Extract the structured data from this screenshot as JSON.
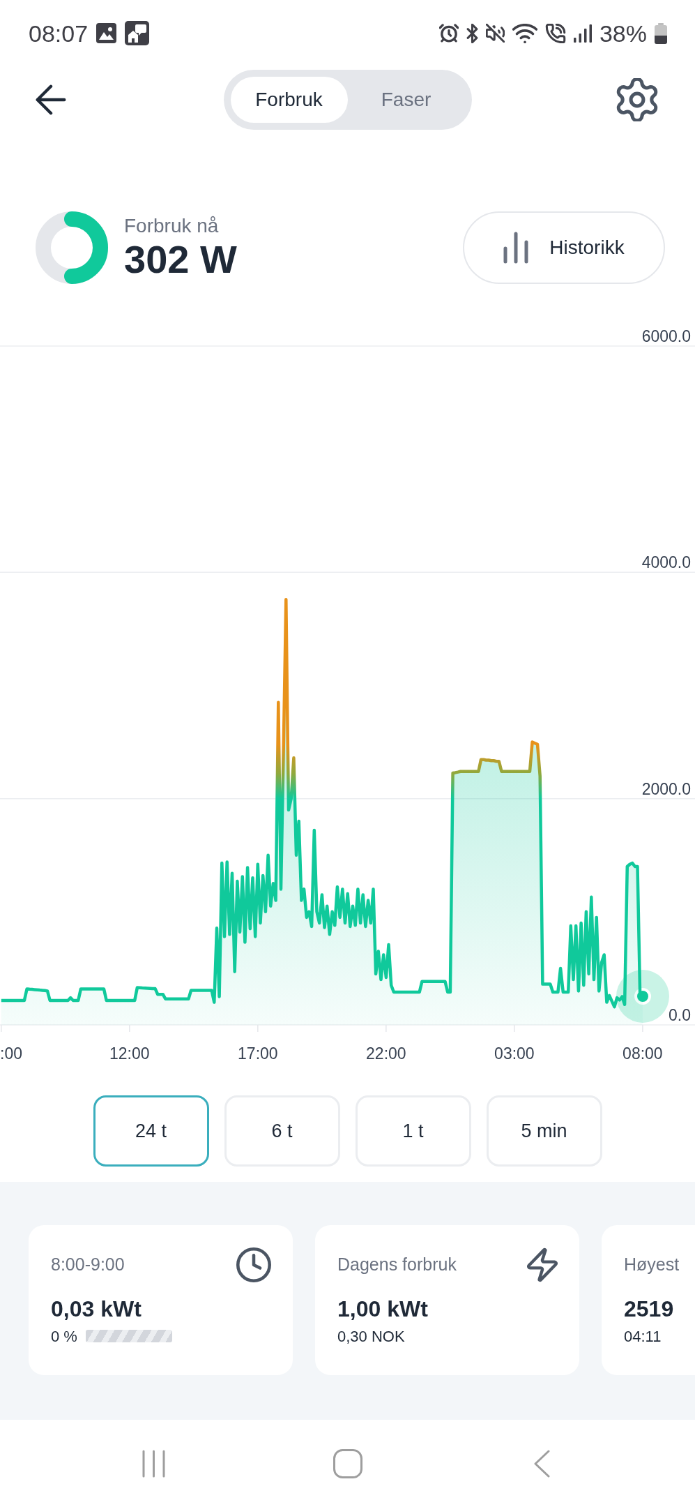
{
  "status_bar": {
    "time": "08:07",
    "battery": "38%"
  },
  "header": {
    "tabs": [
      {
        "label": "Forbruk",
        "selected": true
      },
      {
        "label": "Faser",
        "selected": false
      }
    ]
  },
  "current": {
    "label": "Forbruk nå",
    "value": "302 W",
    "gauge": {
      "level": 0.5
    },
    "history_button": "Historikk"
  },
  "chart": {
    "chart_data": {
      "type": "area",
      "ylim": [
        0,
        6000
      ],
      "yticks": [
        {
          "value": 0,
          "label": "0.0"
        },
        {
          "value": 2000,
          "label": "2000.0"
        },
        {
          "value": 4000,
          "label": "4000.0"
        },
        {
          "value": 6000,
          "label": "6000.0"
        }
      ],
      "categories": [
        ":00",
        null,
        null,
        null,
        null,
        null,
        null,
        null,
        null,
        null,
        null,
        null,
        null,
        null,
        null,
        null,
        null,
        null,
        null,
        null,
        null,
        null,
        null,
        null,
        null,
        null,
        null,
        null,
        null,
        null,
        null,
        null,
        null,
        null,
        null,
        null,
        null,
        null,
        null,
        null,
        null,
        null,
        null,
        null,
        null,
        null,
        null,
        null,
        null,
        null,
        "12:00",
        null,
        null,
        null,
        null,
        null,
        null,
        null,
        null,
        null,
        null,
        null,
        null,
        null,
        null,
        null,
        null,
        null,
        null,
        null,
        null,
        null,
        null,
        null,
        null,
        null,
        null,
        null,
        null,
        null,
        null,
        null,
        null,
        null,
        null,
        null,
        null,
        null,
        null,
        null,
        null,
        null,
        null,
        null,
        null,
        null,
        null,
        null,
        null,
        null,
        "17:00",
        null,
        null,
        null,
        null,
        null,
        null,
        null,
        null,
        null,
        null,
        null,
        null,
        null,
        null,
        null,
        null,
        null,
        null,
        null,
        null,
        null,
        null,
        null,
        null,
        null,
        null,
        null,
        null,
        null,
        null,
        null,
        null,
        null,
        null,
        null,
        null,
        null,
        null,
        null,
        null,
        null,
        null,
        null,
        null,
        null,
        null,
        null,
        null,
        null,
        "22:00",
        null,
        null,
        null,
        null,
        null,
        null,
        null,
        null,
        null,
        null,
        null,
        null,
        null,
        null,
        null,
        null,
        null,
        null,
        null,
        null,
        null,
        null,
        null,
        null,
        null,
        null,
        null,
        null,
        null,
        null,
        null,
        null,
        null,
        null,
        null,
        null,
        null,
        null,
        null,
        null,
        null,
        null,
        null,
        null,
        null,
        null,
        null,
        null,
        null,
        "03:00",
        null,
        null,
        null,
        null,
        null,
        null,
        null,
        null,
        null,
        null,
        null,
        null,
        null,
        null,
        null,
        null,
        null,
        null,
        null,
        null,
        null,
        null,
        null,
        null,
        null,
        null,
        null,
        null,
        null,
        null,
        null,
        null,
        null,
        null,
        null,
        null,
        null,
        null,
        null,
        null,
        null,
        null,
        null,
        null,
        null,
        null,
        null,
        null,
        null,
        "08:00"
      ],
      "values": [
        216,
        216,
        216,
        216,
        216,
        216,
        216,
        216,
        216,
        216,
        318,
        316,
        314,
        312,
        310,
        308,
        306,
        304,
        300,
        216,
        216,
        216,
        216,
        216,
        216,
        216,
        216,
        240,
        216,
        216,
        216,
        318,
        318,
        318,
        318,
        318,
        318,
        318,
        318,
        318,
        318,
        216,
        216,
        216,
        216,
        216,
        216,
        216,
        216,
        216,
        216,
        216,
        216,
        330,
        328,
        326,
        325,
        324,
        322,
        320,
        320,
        270,
        270,
        270,
        230,
        230,
        230,
        230,
        230,
        230,
        230,
        230,
        230,
        230,
        306,
        306,
        306,
        306,
        306,
        306,
        306,
        306,
        306,
        200,
        855,
        250,
        1430,
        780,
        1440,
        800,
        1340,
        470,
        1270,
        820,
        1310,
        730,
        1390,
        850,
        1300,
        780,
        1420,
        900,
        1320,
        1000,
        1500,
        1050,
        1250,
        1100,
        2850,
        1200,
        2400,
        3760,
        1900,
        2000,
        2360,
        1500,
        1800,
        1100,
        1200,
        950,
        1000,
        870,
        1720,
        1000,
        900,
        1150,
        860,
        1050,
        800,
        1000,
        880,
        1220,
        950,
        1200,
        900,
        1160,
        870,
        1050,
        880,
        1200,
        900,
        1150,
        870,
        1100,
        900,
        1200,
        450,
        650,
        400,
        620,
        420,
        710,
        350,
        290,
        290,
        290,
        290,
        290,
        290,
        290,
        290,
        290,
        290,
        290,
        384,
        384,
        384,
        384,
        384,
        384,
        384,
        384,
        384,
        384,
        290,
        290,
        2227,
        2230,
        2235,
        2240,
        2240,
        2240,
        2240,
        2240,
        2240,
        2240,
        2240,
        2345,
        2345,
        2340,
        2340,
        2335,
        2335,
        2330,
        2330,
        2240,
        2240,
        2240,
        2240,
        2240,
        2240,
        2240,
        2240,
        2240,
        2240,
        2240,
        2240,
        2500,
        2490,
        2480,
        2200,
        360,
        360,
        360,
        360,
        290,
        290,
        290,
        500,
        290,
        290,
        290,
        875,
        400,
        875,
        300,
        900,
        350,
        1000,
        450,
        1130,
        400,
        950,
        300,
        550,
        620,
        200,
        260,
        210,
        160,
        240,
        220,
        250,
        180,
        1400,
        1420,
        1430,
        1400,
        1400,
        250,
        255
      ]
    }
  },
  "ranges": [
    {
      "label": "24 t",
      "selected": true
    },
    {
      "label": "6 t",
      "selected": false
    },
    {
      "label": "1 t",
      "selected": false
    },
    {
      "label": "5 min",
      "selected": false
    }
  ],
  "cards": [
    {
      "kind": "hour",
      "label": "8:00-9:00",
      "value": "0,03 kWt",
      "share": "0 %"
    },
    {
      "kind": "day",
      "label": "Dagens forbruk",
      "value": "1,00 kWt",
      "detail": "0,30 NOK"
    },
    {
      "kind": "peak",
      "label": "Høyest",
      "value": "2519",
      "detail": "04:11"
    }
  ]
}
